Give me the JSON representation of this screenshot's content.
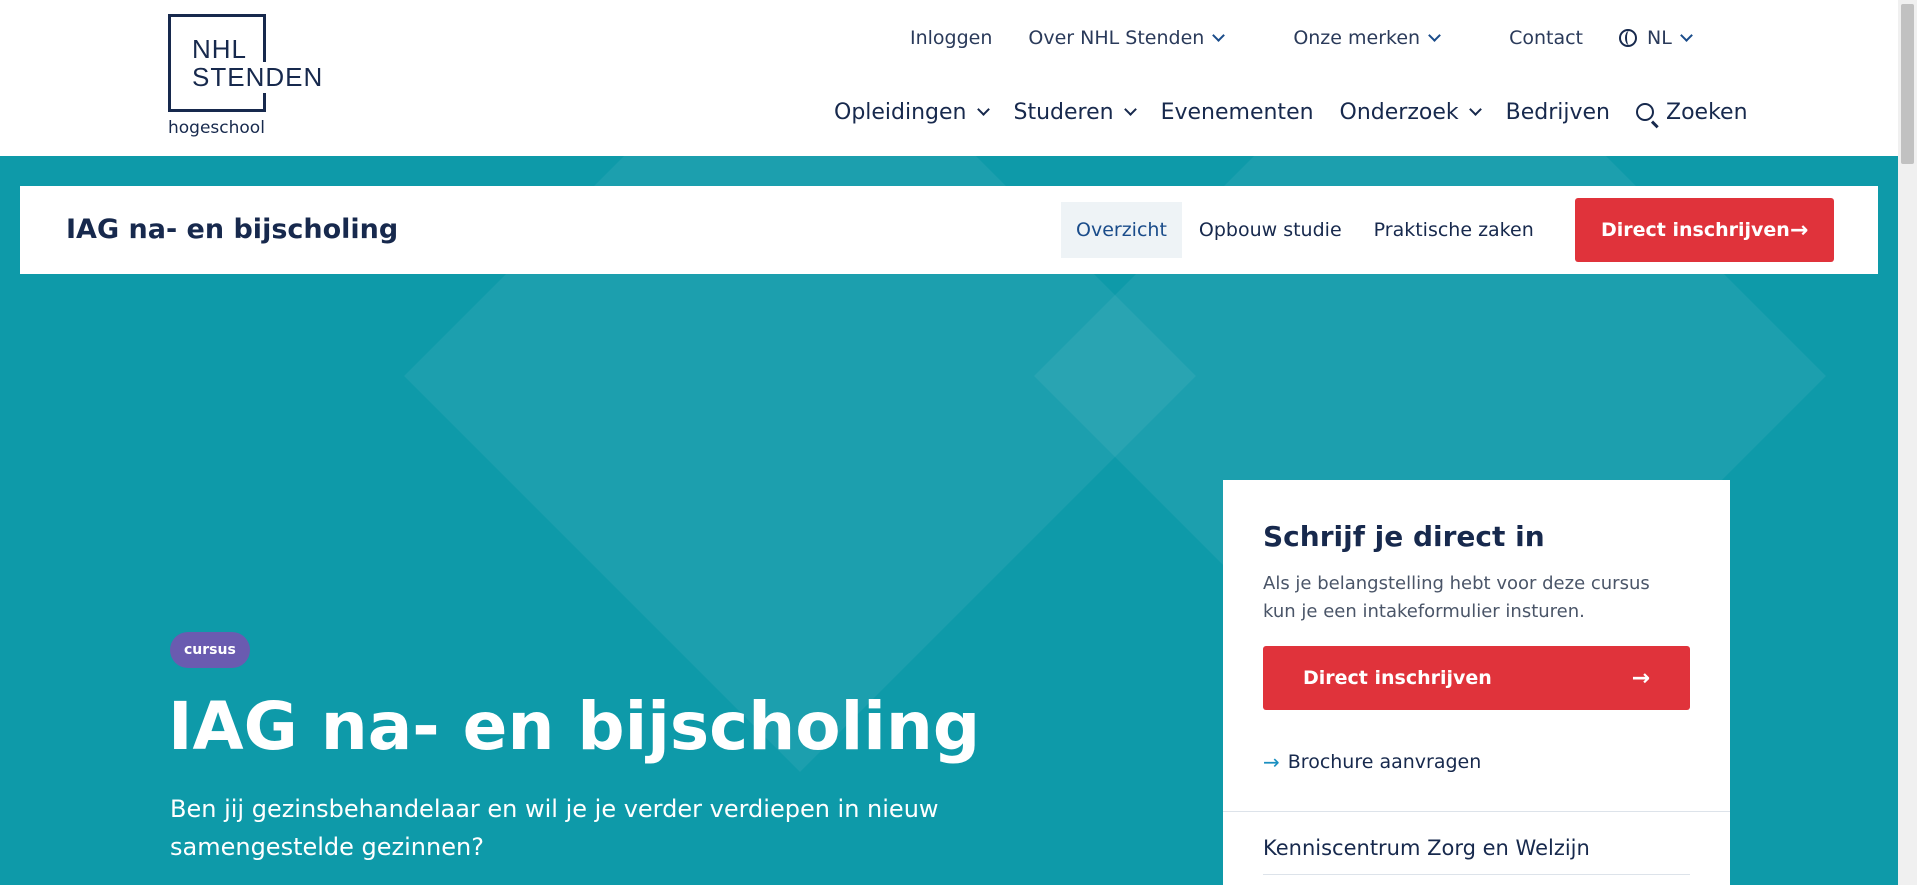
{
  "logo": {
    "line1": "NHL",
    "line2": "STENDEN",
    "sub": "hogeschool"
  },
  "topnav": {
    "login": "Inloggen",
    "about": "Over NHL Stenden",
    "brands": "Onze merken",
    "contact": "Contact",
    "language": "NL"
  },
  "mainnav": {
    "items": [
      "Opleidingen",
      "Studeren",
      "Evenementen",
      "Onderzoek",
      "Bedrijven"
    ],
    "search": "Zoeken"
  },
  "subnav": {
    "title": "IAG na- en bijscholing",
    "tabs": [
      "Overzicht",
      "Opbouw studie",
      "Praktische zaken"
    ],
    "cta": "Direct inschrijven"
  },
  "hero": {
    "badge": "cursus",
    "title": "IAG na- en bijscholing",
    "intro": "Ben jij gezinsbehandelaar en wil je je verder verdiepen in nieuw samengestelde gezinnen?"
  },
  "card": {
    "title": "Schrijf je direct in",
    "text": "Als je belangstelling hebt voor deze cursus kun je een intakeformulier insturen.",
    "cta": "Direct inschrijven",
    "link": "Brochure aanvragen",
    "item": "Kenniscentrum Zorg en Welzijn"
  },
  "colors": {
    "primary": "#17294d",
    "hero_bg": "#0e9aa9",
    "cta_red": "#e0333b",
    "badge_purple": "#6a5bb0"
  }
}
